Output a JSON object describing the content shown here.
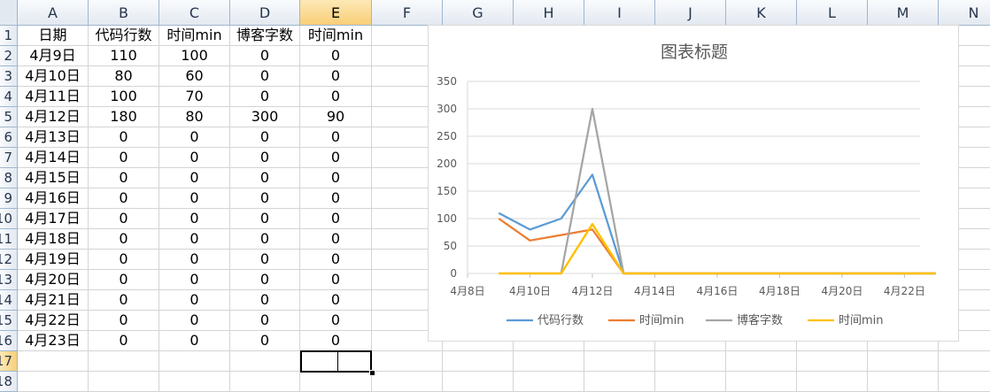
{
  "spreadsheet": {
    "columns": [
      "A",
      "B",
      "C",
      "D",
      "E",
      "F",
      "G",
      "H",
      "I",
      "J",
      "K",
      "L",
      "M",
      "N"
    ],
    "selected_column": "E",
    "rows": [
      "1",
      "2",
      "3",
      "4",
      "5",
      "6",
      "7",
      "8",
      "9",
      "10",
      "11",
      "12",
      "13",
      "14",
      "15",
      "16",
      "17",
      "18"
    ],
    "selected_row": "17",
    "header": [
      "日期",
      "代码行数",
      "时间min",
      "博客字数",
      "时间min"
    ],
    "data": [
      [
        "4月9日",
        "110",
        "100",
        "0",
        "0"
      ],
      [
        "4月10日",
        "80",
        "60",
        "0",
        "0"
      ],
      [
        "4月11日",
        "100",
        "70",
        "0",
        "0"
      ],
      [
        "4月12日",
        "180",
        "80",
        "300",
        "90"
      ],
      [
        "4月13日",
        "0",
        "0",
        "0",
        "0"
      ],
      [
        "4月14日",
        "0",
        "0",
        "0",
        "0"
      ],
      [
        "4月15日",
        "0",
        "0",
        "0",
        "0"
      ],
      [
        "4月16日",
        "0",
        "0",
        "0",
        "0"
      ],
      [
        "4月17日",
        "0",
        "0",
        "0",
        "0"
      ],
      [
        "4月18日",
        "0",
        "0",
        "0",
        "0"
      ],
      [
        "4月19日",
        "0",
        "0",
        "0",
        "0"
      ],
      [
        "4月20日",
        "0",
        "0",
        "0",
        "0"
      ],
      [
        "4月21日",
        "0",
        "0",
        "0",
        "0"
      ],
      [
        "4月22日",
        "0",
        "0",
        "0",
        "0"
      ],
      [
        "4月23日",
        "0",
        "0",
        "0",
        "0"
      ]
    ]
  },
  "chart_data": {
    "type": "line",
    "title": "图表标题",
    "x": [
      "4月9日",
      "4月10日",
      "4月11日",
      "4月12日",
      "4月13日",
      "4月14日",
      "4月15日",
      "4月16日",
      "4月17日",
      "4月18日",
      "4月19日",
      "4月20日",
      "4月21日",
      "4月22日",
      "4月23日"
    ],
    "x_day_index": [
      9,
      10,
      11,
      12,
      13,
      14,
      15,
      16,
      17,
      18,
      19,
      20,
      21,
      22,
      23
    ],
    "x_tick_labels": [
      "4月8日",
      "4月10日",
      "4月12日",
      "4月14日",
      "4月16日",
      "4月18日",
      "4月20日",
      "4月22日"
    ],
    "x_tick_days": [
      8,
      10,
      12,
      14,
      16,
      18,
      20,
      22
    ],
    "xlim": [
      8,
      22.5
    ],
    "ylim": [
      0,
      350
    ],
    "y_ticks": [
      0,
      50,
      100,
      150,
      200,
      250,
      300,
      350
    ],
    "grid": true,
    "legend_position": "bottom",
    "series": [
      {
        "name": "代码行数",
        "color": "#5b9bd5",
        "values": [
          110,
          80,
          100,
          180,
          0,
          0,
          0,
          0,
          0,
          0,
          0,
          0,
          0,
          0,
          0
        ]
      },
      {
        "name": "时间min",
        "color": "#ed7d31",
        "values": [
          100,
          60,
          70,
          80,
          0,
          0,
          0,
          0,
          0,
          0,
          0,
          0,
          0,
          0,
          0
        ]
      },
      {
        "name": "博客字数",
        "color": "#a5a5a5",
        "values": [
          0,
          0,
          0,
          300,
          0,
          0,
          0,
          0,
          0,
          0,
          0,
          0,
          0,
          0,
          0
        ]
      },
      {
        "name": "时间min",
        "color": "#ffc000",
        "values": [
          0,
          0,
          0,
          90,
          0,
          0,
          0,
          0,
          0,
          0,
          0,
          0,
          0,
          0,
          0
        ]
      }
    ]
  }
}
